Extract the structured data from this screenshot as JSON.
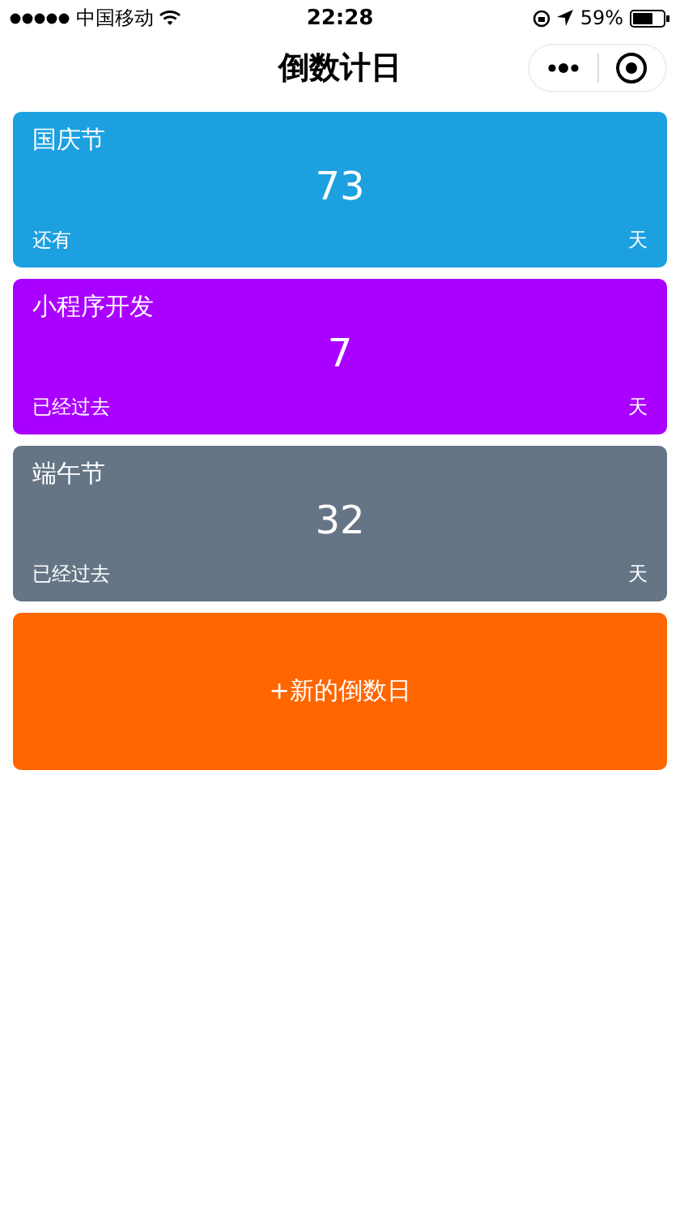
{
  "status_bar": {
    "carrier": "中国移动",
    "time": "22:28",
    "battery": "59%"
  },
  "nav": {
    "title": "倒数计日"
  },
  "events": [
    {
      "name": "国庆节",
      "days": "73",
      "prefix": "还有",
      "unit": "天",
      "color": "#1ca0e0"
    },
    {
      "name": "小程序开发",
      "days": "7",
      "prefix": "已经过去",
      "unit": "天",
      "color": "#aa00ff"
    },
    {
      "name": "端午节",
      "days": "32",
      "prefix": "已经过去",
      "unit": "天",
      "color": "#657585"
    }
  ],
  "add_button": {
    "label": "+新的倒数日"
  }
}
